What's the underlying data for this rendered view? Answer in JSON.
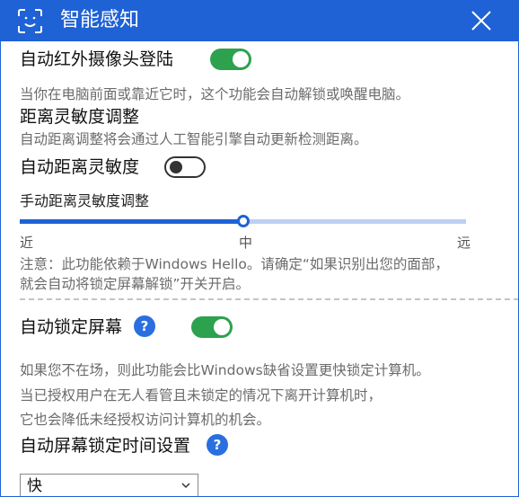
{
  "window": {
    "title": "智能感知"
  },
  "ir_login": {
    "label": "自动红外摄像头登陆",
    "enabled": true,
    "description": "当你在电脑前面或靠近它时，这个功能会自动解锁或唤醒电脑。"
  },
  "distance_sensitivity": {
    "heading": "距离灵敏度调整",
    "description": "自动距离调整将会通过人工智能引擎自动更新检测距离。",
    "auto_label": "自动距离灵敏度",
    "auto_enabled": false,
    "manual_label": "手动距离灵敏度调整",
    "slider": {
      "min_label": "近",
      "mid_label": "中",
      "max_label": "远",
      "value_fraction": 0.5
    },
    "note_line1": "注意：此功能依赖于Windows Hello。请确定“如果识别出您的面部，",
    "note_line2": "就会自动将锁定屏幕解锁”开关开启。"
  },
  "auto_lock": {
    "label": "自动锁定屏幕",
    "help": "?",
    "enabled": true,
    "desc_line1": "如果您不在场，则此功能会比Windows缺省设置更快锁定计算机。",
    "desc_line2": "当已授权用户在无人看管且未锁定的情况下离开计算机时，",
    "desc_line3": "它也会降低未经授权访问计算机的机会。"
  },
  "lock_timeout": {
    "label": "自动屏幕锁定时间设置",
    "help": "?",
    "selected": "快"
  },
  "colors": {
    "accent": "#1f62d6",
    "toggle_on": "#2ca24f",
    "slider_track": "#bcd0f1"
  },
  "icons": {
    "title": "face-recognition-icon",
    "close": "close-icon",
    "help": "help-icon",
    "dropdown": "chevron-down-icon"
  }
}
